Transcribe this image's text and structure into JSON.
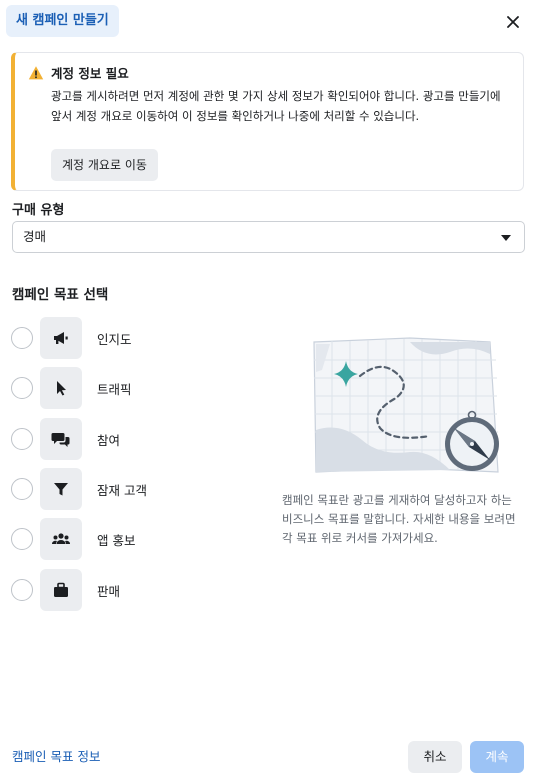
{
  "header": {
    "title": "새 캠페인 만들기",
    "close_icon": "close-icon"
  },
  "alert": {
    "icon": "warning-icon",
    "accent_color": "#f2b134",
    "title": "계정 정보 필요",
    "body": "광고를 게시하려면 먼저 계정에 관한 몇 가지 상세 정보가 확인되어야 합니다. 광고를 만들기에 앞서 계정 개요로 이동하여 이 정보를 확인하거나 나중에 처리할 수 있습니다.",
    "button_label": "계정 개요로 이동"
  },
  "buying_type": {
    "label": "구매 유형",
    "selected": "경매"
  },
  "objectives": {
    "title": "캠페인 목표 선택",
    "items": [
      {
        "label": "인지도",
        "icon": "megaphone-icon"
      },
      {
        "label": "트래픽",
        "icon": "cursor-icon"
      },
      {
        "label": "참여",
        "icon": "chat-bubbles-icon"
      },
      {
        "label": "잠재 고객",
        "icon": "funnel-icon"
      },
      {
        "label": "앱 홍보",
        "icon": "people-icon"
      },
      {
        "label": "판매",
        "icon": "shopping-bag-icon"
      }
    ]
  },
  "illustration": {
    "icon": "map-compass-illustration"
  },
  "description": "캠페인 목표란 광고를 게재하여 달성하고자 하는 비즈니스 목표를 말합니다. 자세한 내용을 보려면 각 목표 위로 커서를 가져가세요.",
  "footer": {
    "info_link": "캠페인 목표 정보",
    "cancel_label": "취소",
    "continue_label": "계속",
    "primary_color": "#9cc3f5"
  }
}
